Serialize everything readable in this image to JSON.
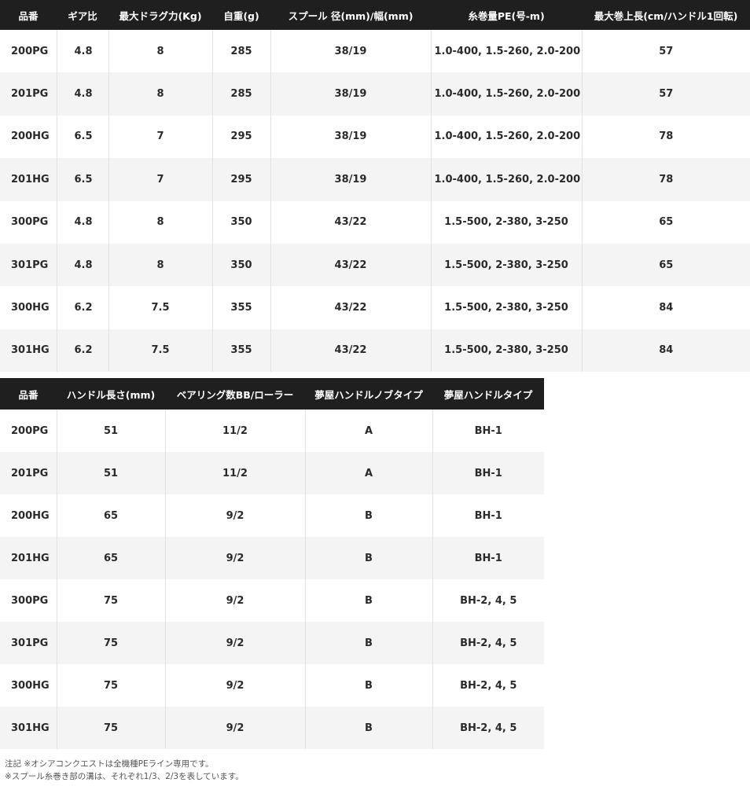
{
  "table1": {
    "headers": [
      "品番",
      "ギア比",
      "最大ドラグ力(Kg)",
      "自重(g)",
      "スプール 径(mm)/幅(mm)",
      "糸巻量PE(号-m)",
      "最大巻上長(cm/ハンドル1回転)"
    ],
    "rows": [
      [
        "200PG",
        "4.8",
        "8",
        "285",
        "38/19",
        "1.0-400, 1.5-260, 2.0-200",
        "57"
      ],
      [
        "201PG",
        "4.8",
        "8",
        "285",
        "38/19",
        "1.0-400, 1.5-260, 2.0-200",
        "57"
      ],
      [
        "200HG",
        "6.5",
        "7",
        "295",
        "38/19",
        "1.0-400, 1.5-260, 2.0-200",
        "78"
      ],
      [
        "201HG",
        "6.5",
        "7",
        "295",
        "38/19",
        "1.0-400, 1.5-260, 2.0-200",
        "78"
      ],
      [
        "300PG",
        "4.8",
        "8",
        "350",
        "43/22",
        "1.5-500, 2-380, 3-250",
        "65"
      ],
      [
        "301PG",
        "4.8",
        "8",
        "350",
        "43/22",
        "1.5-500, 2-380, 3-250",
        "65"
      ],
      [
        "300HG",
        "6.2",
        "7.5",
        "355",
        "43/22",
        "1.5-500, 2-380, 3-250",
        "84"
      ],
      [
        "301HG",
        "6.2",
        "7.5",
        "355",
        "43/22",
        "1.5-500, 2-380, 3-250",
        "84"
      ]
    ]
  },
  "table2": {
    "headers": [
      "品番",
      "ハンドル長さ(mm)",
      "ベアリング数BB/ローラー",
      "夢屋ハンドルノブタイプ",
      "夢屋ハンドルタイプ"
    ],
    "rows": [
      [
        "200PG",
        "51",
        "11/2",
        "A",
        "BH-1"
      ],
      [
        "201PG",
        "51",
        "11/2",
        "A",
        "BH-1"
      ],
      [
        "200HG",
        "65",
        "9/2",
        "B",
        "BH-1"
      ],
      [
        "201HG",
        "65",
        "9/2",
        "B",
        "BH-1"
      ],
      [
        "300PG",
        "75",
        "9/2",
        "B",
        "BH-2, 4, 5"
      ],
      [
        "301PG",
        "75",
        "9/2",
        "B",
        "BH-2, 4, 5"
      ],
      [
        "300HG",
        "75",
        "9/2",
        "B",
        "BH-2, 4, 5"
      ],
      [
        "301HG",
        "75",
        "9/2",
        "B",
        "BH-2, 4, 5"
      ]
    ]
  },
  "notes": {
    "line1": "注記 ※オシアコンクエストは全機種PEライン専用です。",
    "line2": "※スプール糸巻き部の溝は、それぞれ1/3、2/3を表しています。"
  }
}
